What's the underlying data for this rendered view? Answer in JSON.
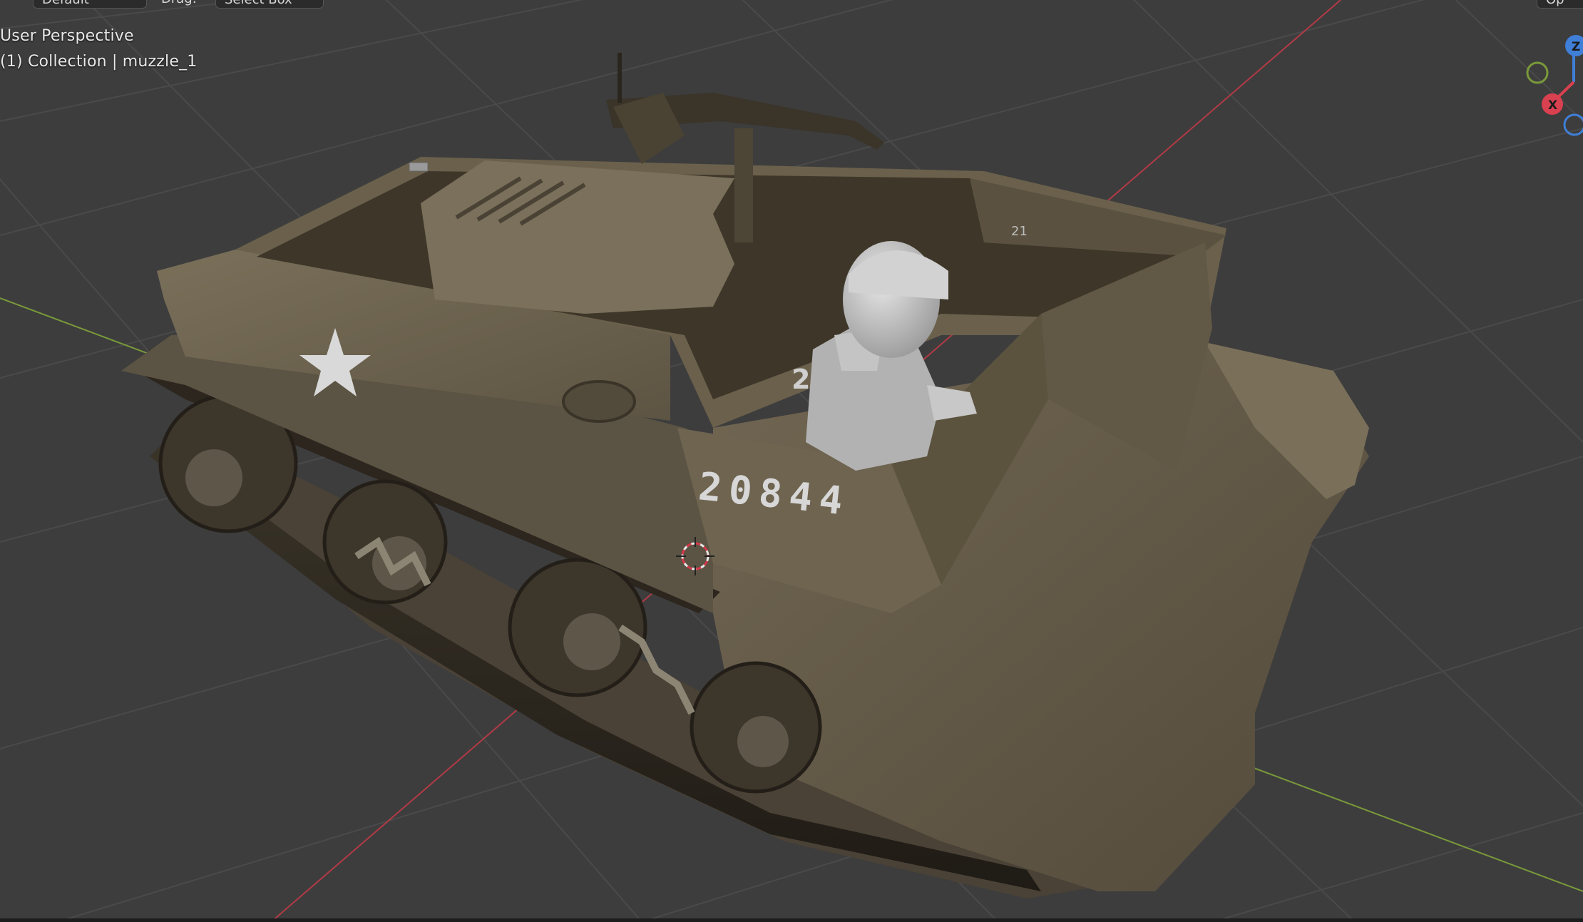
{
  "viewport": {
    "view_name": "User Perspective",
    "collection_line": "(1) Collection | muzzle_1",
    "vehicle_number": "20844",
    "side_marking": "2",
    "model_marking": "21"
  },
  "header": {
    "mode_label": "Default",
    "drag_label": "Drag:",
    "drag_value": "Select Box",
    "right_button_label": "Op"
  },
  "gizmo": {
    "z_label": "Z",
    "x_label": "X"
  },
  "colors": {
    "background": "#3d3d3d",
    "grid_line": "#4a4a4a",
    "x_axis": "#b23a46",
    "y_axis": "#7a9a3a",
    "z_axis_gizmo": "#3f7fd8",
    "x_axis_gizmo": "#d94050",
    "y_axis_gizmo": "#7a9a3a",
    "vehicle_olive": "#6b614b",
    "figure_gray": "#b7b7b7"
  }
}
